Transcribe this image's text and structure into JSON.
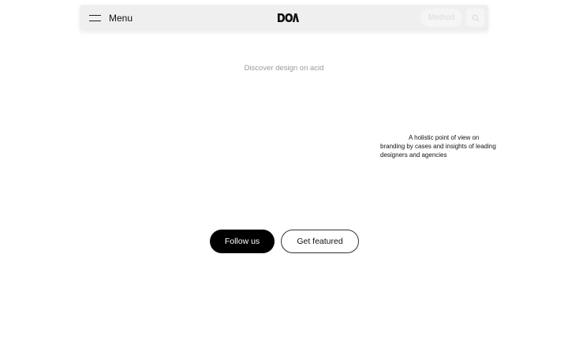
{
  "navbar": {
    "menu_label": "Menu",
    "menu_icon": "hamburger-icon",
    "logo_text": "DOA",
    "method_label": "Method",
    "search_icon": "search-icon"
  },
  "hero": {
    "tagline": "Discover design on acid",
    "description": "A holistic point of view on branding by cases and insights of leading designers and agencies"
  },
  "actions": {
    "follow_label": "Follow us",
    "featured_label": "Get featured"
  },
  "colors": {
    "navbar_bg": "#efefef",
    "primary_button": "#000000",
    "tagline_text": "#9a9a9a"
  }
}
